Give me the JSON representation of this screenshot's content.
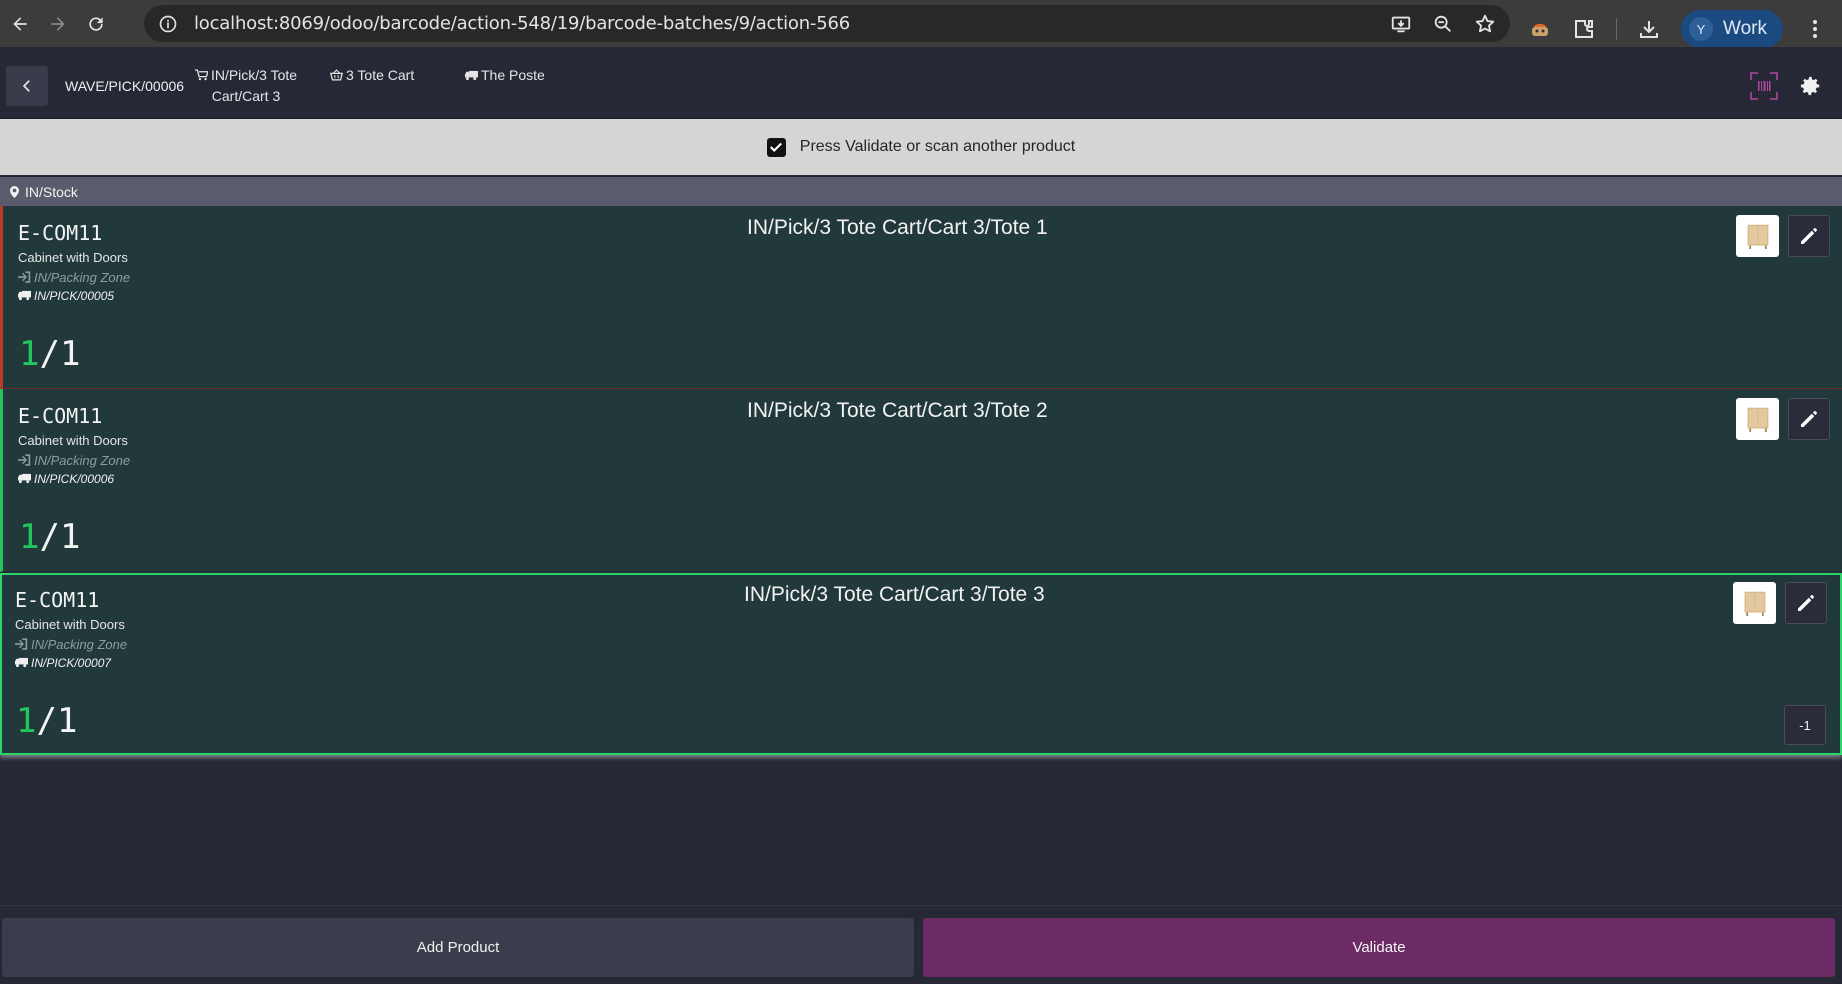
{
  "browser": {
    "url": "localhost:8069/odoo/barcode/action-548/19/barcode-batches/9/action-566",
    "profile_initial": "Y",
    "profile_name": "Work"
  },
  "header": {
    "reference": "WAVE/PICK/00006",
    "cart": "IN/Pick/3 Tote Cart/Cart 3",
    "tote_type": "3 Tote Cart",
    "carrier": "The Poste"
  },
  "status": {
    "message": "Press Validate or scan another product"
  },
  "location": {
    "name": "IN/Stock"
  },
  "lines": [
    {
      "product_code": "E-COM11",
      "product_name": "Cabinet with Doors",
      "destination": "IN/Packing Zone",
      "picking": "IN/PICK/00005",
      "qty_done": "1",
      "qty_total": "/1",
      "package": "IN/Pick/3 Tote Cart/Cart 3/Tote 1"
    },
    {
      "product_code": "E-COM11",
      "product_name": "Cabinet with Doors",
      "destination": "IN/Packing Zone",
      "picking": "IN/PICK/00006",
      "qty_done": "1",
      "qty_total": "/1",
      "package": "IN/Pick/3 Tote Cart/Cart 3/Tote 2"
    },
    {
      "product_code": "E-COM11",
      "product_name": "Cabinet with Doors",
      "destination": "IN/Packing Zone",
      "picking": "IN/PICK/00007",
      "qty_done": "1",
      "qty_total": "/1",
      "package": "IN/Pick/3 Tote Cart/Cart 3/Tote 3",
      "decrement_label": "-1"
    }
  ],
  "footer": {
    "add_product_label": "Add Product",
    "validate_label": "Validate"
  },
  "colors": {
    "done_qty": "#22c55e",
    "validate": "#6d2b66",
    "line_bg": "#22393b",
    "error_border": "#c0392b",
    "success_border": "#23c55e"
  },
  "icons": {
    "cart": "cart-icon",
    "basket": "basket-icon",
    "truck": "truck-icon",
    "location": "map-pin-icon",
    "destination": "sign-in-icon",
    "edit": "pencil-icon",
    "scan": "barcode-scan-icon",
    "settings": "gear-icon"
  }
}
